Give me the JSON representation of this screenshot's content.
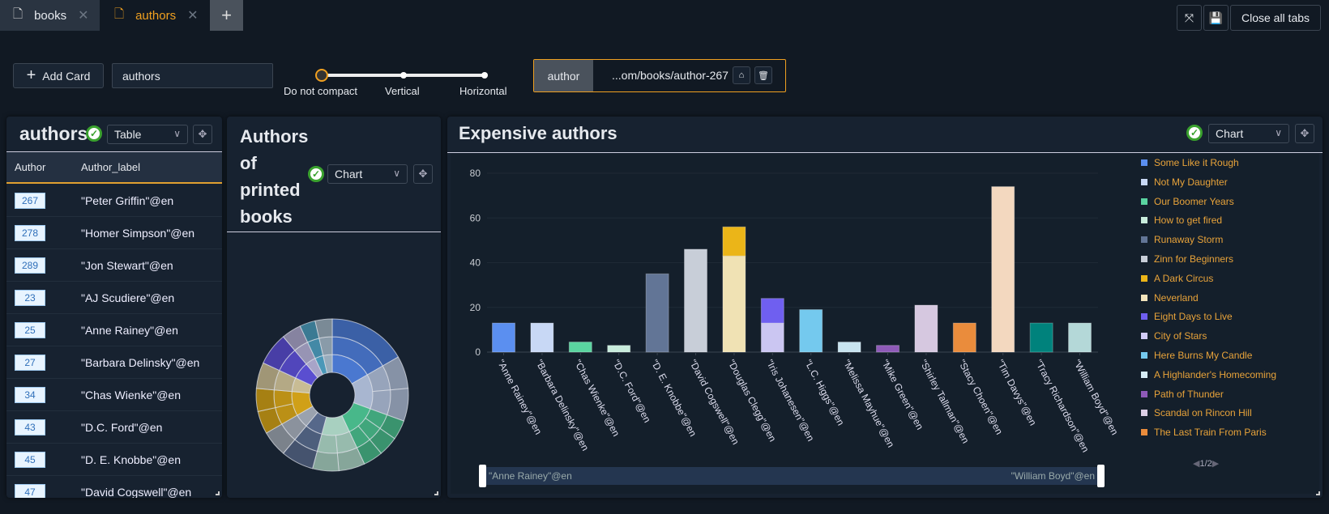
{
  "tabs": [
    {
      "label": "books",
      "active": false
    },
    {
      "label": "authors",
      "active": true
    }
  ],
  "toolbar": {
    "add_card": "Add Card",
    "search_value": "authors",
    "close_all": "Close all tabs",
    "compact_options": [
      "Do not compact",
      "Vertical",
      "Horizontal"
    ],
    "compact_selected": "Do not compact",
    "filter": {
      "key": "author",
      "value": "...om/books/author-267"
    }
  },
  "colors": {
    "accent": "#f0a020",
    "background": "#111923",
    "card": "#172230"
  },
  "cards": {
    "authors": {
      "title": "authors",
      "view": "Table",
      "columns": [
        "Author",
        "Author_label"
      ],
      "rows": [
        {
          "id": "267",
          "label": "\"Peter Griffin\"@en"
        },
        {
          "id": "278",
          "label": "\"Homer Simpson\"@en"
        },
        {
          "id": "289",
          "label": "\"Jon Stewart\"@en"
        },
        {
          "id": "23",
          "label": "\"AJ Scudiere\"@en"
        },
        {
          "id": "25",
          "label": "\"Anne Rainey\"@en"
        },
        {
          "id": "27",
          "label": "\"Barbara Delinsky\"@en"
        },
        {
          "id": "34",
          "label": "\"Chas Wienke\"@en"
        },
        {
          "id": "43",
          "label": "\"D.C. Ford\"@en"
        },
        {
          "id": "45",
          "label": "\"D. E. Knobbe\"@en"
        },
        {
          "id": "47",
          "label": "\"David Cogswell\"@en"
        }
      ]
    },
    "printed": {
      "title_lines": [
        "Authors",
        "of",
        "printed",
        "books"
      ],
      "view": "Chart"
    },
    "expensive": {
      "title": "Expensive authors",
      "view": "Chart",
      "legend_page": "1/2",
      "zoom_start": "\"Anne Rainey\"@en",
      "zoom_end": "\"William Boyd\"@en"
    }
  },
  "chart_data": [
    {
      "type": "bar",
      "stacked": true,
      "ylim": [
        0,
        80
      ],
      "yticks": [
        0,
        20,
        40,
        60,
        80
      ],
      "grid": true,
      "legend": "right",
      "categories": [
        "\"Anne Rainey\"@en",
        "\"Barbara Delinsky\"@en",
        "\"Chas Wienke\"@en",
        "\"D.C. Ford\"@en",
        "\"D. E. Knobbe\"@en",
        "\"David Cogswell\"@en",
        "\"Douglas Clegg\"@en",
        "\"Iris Johanesen\"@en",
        "\"L.C. Higgs\"@en",
        "\"Melissa Mayhue\"@en",
        "\"Mike Green\"@en",
        "\"Shirley Tallman\"@en",
        "\"Stacy Choen\"@en",
        "\"Tim Davys\"@en",
        "\"Tracy Richardson\"@en",
        "\"William Boyd\"@en"
      ],
      "bars": [
        [
          {
            "series": "Some Like it Rough",
            "value": 13,
            "color": "#5b8ff0"
          }
        ],
        [
          {
            "series": "Not My Daughter",
            "value": 13,
            "color": "#c8d8f5"
          }
        ],
        [
          {
            "series": "Our Boomer Years",
            "value": 4.5,
            "color": "#5ad4a0"
          }
        ],
        [
          {
            "series": "How to get fired",
            "value": 3,
            "color": "#c8ecdc"
          }
        ],
        [
          {
            "series": "Runaway Storm",
            "value": 35,
            "color": "#627596"
          }
        ],
        [
          {
            "series": "Zinn for Beginners",
            "value": 46,
            "color": "#c8ced8"
          }
        ],
        [
          {
            "series": "Neverland",
            "value": 43,
            "color": "#f0e2b4"
          },
          {
            "series": "A Dark Circus",
            "value": 13,
            "color": "#ebb518"
          }
        ],
        [
          {
            "series": "City of Stars",
            "value": 13,
            "color": "#cbc6f2"
          },
          {
            "series": "Eight Days to Live",
            "value": 11,
            "color": "#6f5ff0"
          }
        ],
        [
          {
            "series": "Here Burns My Candle",
            "value": 19,
            "color": "#74c9ee"
          }
        ],
        [
          {
            "series": "A Highlander's Homecoming",
            "value": 4.5,
            "color": "#c8e4f0"
          }
        ],
        [
          {
            "series": "Path of Thunder",
            "value": 3,
            "color": "#8e5ab8"
          }
        ],
        [
          {
            "series": "Scandal on Rincon Hill",
            "value": 21,
            "color": "#d6c8e0"
          }
        ],
        [
          {
            "series": "The Last Train From Paris",
            "value": 13,
            "color": "#ea8c3c"
          }
        ],
        [
          {
            "value": 74,
            "color": "#f3d8bf"
          }
        ],
        [
          {
            "value": 13,
            "color": "#00827c"
          }
        ],
        [
          {
            "value": 13,
            "color": "#b4d8d8"
          }
        ]
      ],
      "legend_items": [
        {
          "name": "Some Like it Rough",
          "color": "#5b8ff0"
        },
        {
          "name": "Not My Daughter",
          "color": "#c8d8f5"
        },
        {
          "name": "Our Boomer Years",
          "color": "#5ad4a0"
        },
        {
          "name": "How to get fired",
          "color": "#c8ecdc"
        },
        {
          "name": "Runaway Storm",
          "color": "#627596"
        },
        {
          "name": "Zinn for Beginners",
          "color": "#c8ced8"
        },
        {
          "name": "A Dark Circus",
          "color": "#ebb518"
        },
        {
          "name": "Neverland",
          "color": "#f3e4bc"
        },
        {
          "name": "Eight Days to Live",
          "color": "#6f5ff0"
        },
        {
          "name": "City of Stars",
          "color": "#d2ccf8"
        },
        {
          "name": "Here Burns My Candle",
          "color": "#74c9ee"
        },
        {
          "name": "A Highlander's Homecoming",
          "color": "#d6ecf6"
        },
        {
          "name": "Path of Thunder",
          "color": "#8e5ab8"
        },
        {
          "name": "Scandal on Rincon Hill",
          "color": "#dccfe6"
        },
        {
          "name": "The Last Train From Paris",
          "color": "#ea8c3c"
        }
      ]
    },
    {
      "type": "sunburst",
      "segments": [
        {
          "value": 60,
          "color": "#4a78d0",
          "children": 1
        },
        {
          "value": 50,
          "color": "#a8b6d0",
          "children": 2
        },
        {
          "value": 45,
          "color": "#48b88a",
          "children": 3
        },
        {
          "value": 40,
          "color": "#a8d0c0",
          "children": 2
        },
        {
          "value": 25,
          "color": "#56688a",
          "children": 1
        },
        {
          "value": 20,
          "color": "#9aa2ae",
          "children": 1
        },
        {
          "value": 35,
          "color": "#d0a018",
          "children": 2
        },
        {
          "value": 20,
          "color": "#c8bc94",
          "children": 1
        },
        {
          "value": 25,
          "color": "#5a4ed0",
          "children": 1
        },
        {
          "value": 15,
          "color": "#a8a4c8",
          "children": 1
        },
        {
          "value": 12,
          "color": "#4a98b8",
          "children": 1
        },
        {
          "value": 13,
          "color": "#98acbc",
          "children": 1
        }
      ]
    }
  ]
}
